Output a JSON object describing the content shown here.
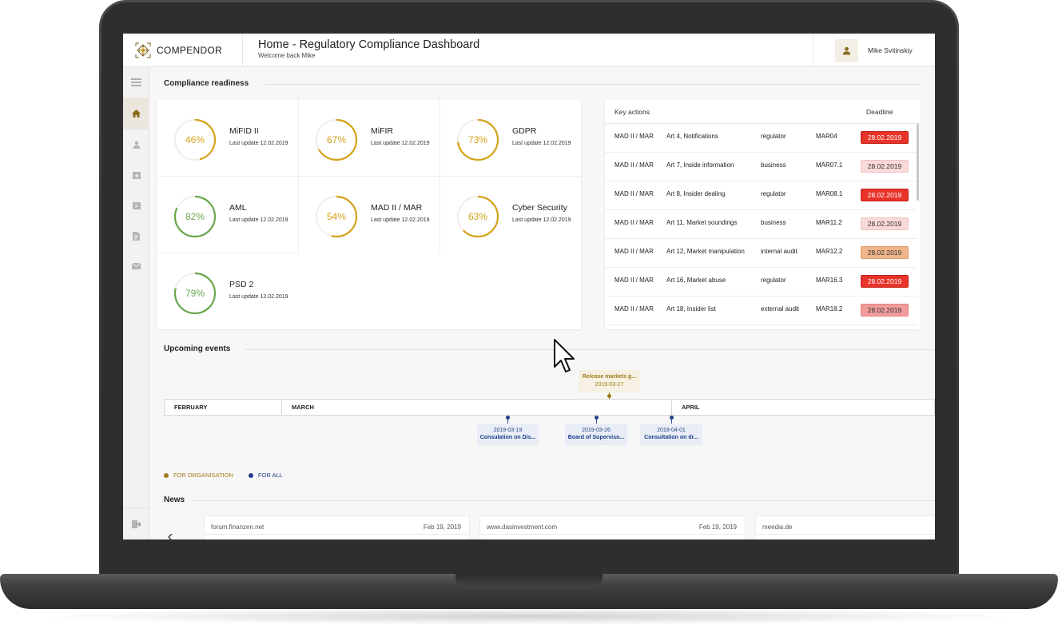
{
  "brand": {
    "name": "COMPENDOR"
  },
  "header": {
    "title": "Home - Regulatory Compliance Dashboard",
    "subtitle": "Welcome back Mike"
  },
  "user": {
    "name": "Mike Svitinskiy"
  },
  "sidebar": {
    "items": [
      {
        "icon": "menu-icon"
      },
      {
        "icon": "home-icon",
        "active": true
      },
      {
        "icon": "user-icon"
      },
      {
        "icon": "calendar-plus-icon"
      },
      {
        "icon": "calendar-icon"
      },
      {
        "icon": "document-icon"
      },
      {
        "icon": "mail-icon"
      },
      {
        "icon": "logout-icon"
      }
    ]
  },
  "readiness": {
    "title": "Compliance readiness",
    "items": [
      {
        "name": "MiFID II",
        "percent": 46,
        "pct_label": "46%",
        "update": "Last update 12.02.2019",
        "color": "#d4a21a"
      },
      {
        "name": "MiFIR",
        "percent": 67,
        "pct_label": "67%",
        "update": "Last update 12.02.2019",
        "color": "#d4a21a"
      },
      {
        "name": "GDPR",
        "percent": 73,
        "pct_label": "73%",
        "update": "Last update 12.02.2019",
        "color": "#d4a21a"
      },
      {
        "name": "AML",
        "percent": 82,
        "pct_label": "82%",
        "update": "Last update 12.02.2019",
        "color": "#6aa84f"
      },
      {
        "name": "MAD II / MAR",
        "percent": 54,
        "pct_label": "54%",
        "update": "Last update 12.02.2019",
        "color": "#d4a21a"
      },
      {
        "name": "Cyber Security",
        "percent": 63,
        "pct_label": "63%",
        "update": "Last update 12.02.2019",
        "color": "#d4a21a"
      },
      {
        "name": "PSD 2",
        "percent": 79,
        "pct_label": "79%",
        "update": "Last update 12.02.2019",
        "color": "#6aa84f"
      }
    ]
  },
  "key_actions": {
    "header_key": "Key actions",
    "header_deadline": "Deadline",
    "rows": [
      {
        "reg": "MAD II / MAR",
        "article": "Art 4, Notifications",
        "owner": "regulator",
        "code": "MAR04",
        "deadline": "28.02.2019",
        "status": "overdue"
      },
      {
        "reg": "MAD II / MAR",
        "article": "Art 7, Inside information",
        "owner": "business",
        "code": "MAR07.1",
        "deadline": "28.02.2019",
        "status": "light"
      },
      {
        "reg": "MAD II / MAR",
        "article": "Art 8, Insider dealing",
        "owner": "regulator",
        "code": "MAR08.1",
        "deadline": "28.02.2019",
        "status": "overdue"
      },
      {
        "reg": "MAD II / MAR",
        "article": "Art 11, Market soundings",
        "owner": "business",
        "code": "MAR11.2",
        "deadline": "28.02.2019",
        "status": "light"
      },
      {
        "reg": "MAD II / MAR",
        "article": "Art 12, Market manipulation",
        "owner": "internal audit",
        "code": "MAR12.2",
        "deadline": "28.02.2019",
        "status": "warning"
      },
      {
        "reg": "MAD II / MAR",
        "article": "Art 16, Market abuse",
        "owner": "regulator",
        "code": "MAR16.3",
        "deadline": "28.02.2019",
        "status": "overdue"
      },
      {
        "reg": "MAD II / MAR",
        "article": "Art 18, Insider list",
        "owner": "external audit",
        "code": "MAR18.2",
        "deadline": "28.02.2019",
        "status": "medium"
      }
    ],
    "status_colors": {
      "overdue": {
        "bg": "#e8332a",
        "fg": "#ffffff",
        "border": "#c0241c"
      },
      "light": {
        "bg": "#f9d9d9",
        "fg": "#333333",
        "border": "#f1c4c4"
      },
      "warning": {
        "bg": "#efb58a",
        "fg": "#333333",
        "border": "#e29c68"
      },
      "medium": {
        "bg": "#f19b9b",
        "fg": "#333333",
        "border": "#e47f7f"
      }
    }
  },
  "events": {
    "title": "Upcoming events",
    "months": [
      "FEBRUARY",
      "MARCH",
      "APRIL"
    ],
    "organisation_events": [
      {
        "title": "Release markets g...",
        "date": "2019-03-27"
      }
    ],
    "public_events": [
      {
        "date": "2019-03-19",
        "title": "Consulation on Dis..."
      },
      {
        "date": "2019-03-26",
        "title": "Board of Superviso..."
      },
      {
        "date": "2019-04-01",
        "title": "Consultation on dr..."
      }
    ],
    "legend": [
      {
        "label": "FOR ORGANISATION",
        "color": "#a07a1c"
      },
      {
        "label": "FOR ALL",
        "color": "#233f8c"
      }
    ]
  },
  "news": {
    "title": "News",
    "items": [
      {
        "source": "forum.finanzen.net",
        "date": "Feb 19, 2019"
      },
      {
        "source": "www.dasinvestment.com",
        "date": "Feb 19, 2019"
      },
      {
        "source": "meedia.de",
        "date": ""
      }
    ]
  }
}
